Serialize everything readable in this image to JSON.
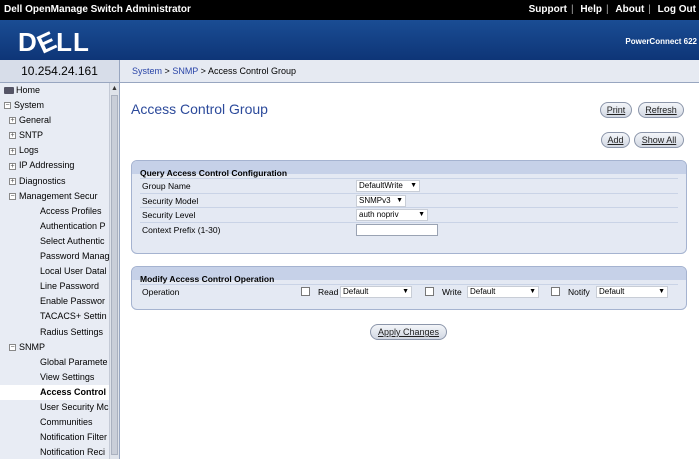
{
  "topbar": {
    "title": "Dell OpenManage Switch Administrator",
    "links": [
      "Support",
      "Help",
      "About",
      "Log Out"
    ]
  },
  "brand": {
    "logo": "DELL",
    "model": "PowerConnect 622"
  },
  "ip": "10.254.24.161",
  "breadcrumb": {
    "items": [
      "System",
      "SNMP"
    ],
    "current": "Access Control Group",
    "sep": ">"
  },
  "nav": {
    "items": [
      {
        "label": "Home",
        "icon": "home-icon"
      },
      {
        "label": "System",
        "icon": "minus-box-icon"
      },
      {
        "label": "General",
        "icon": "plus-box-icon"
      },
      {
        "label": "SNTP",
        "icon": "plus-box-icon"
      },
      {
        "label": "Logs",
        "icon": "plus-box-icon"
      },
      {
        "label": "IP Addressing",
        "icon": "plus-box-icon"
      },
      {
        "label": "Diagnostics",
        "icon": "plus-box-icon"
      },
      {
        "label": "Management Secur",
        "icon": "minus-box-icon"
      },
      {
        "label": "Access Profiles"
      },
      {
        "label": "Authentication P"
      },
      {
        "label": "Select Authentic"
      },
      {
        "label": "Password Manag"
      },
      {
        "label": "Local User Datal"
      },
      {
        "label": "Line Password"
      },
      {
        "label": "Enable Passwor"
      },
      {
        "label": "TACACS+ Settin"
      },
      {
        "label": "Radius Settings"
      },
      {
        "label": "SNMP",
        "icon": "minus-box-icon"
      },
      {
        "label": "Global Paramete"
      },
      {
        "label": "View Settings"
      },
      {
        "label": "Access Control"
      },
      {
        "label": "User Security Mc"
      },
      {
        "label": "Communities"
      },
      {
        "label": "Notification Filter"
      },
      {
        "label": "Notification Reci"
      }
    ]
  },
  "page": {
    "title": "Access Control Group"
  },
  "buttons": {
    "print": "Print",
    "refresh": "Refresh",
    "add": "Add",
    "show_all": "Show All",
    "apply": "Apply Changes"
  },
  "query": {
    "title": "Query Access Control Configuration",
    "group_name": {
      "label": "Group Name",
      "value": "DefaultWrite"
    },
    "security_model": {
      "label": "Security Model",
      "value": "SNMPv3"
    },
    "security_level": {
      "label": "Security Level",
      "value": "auth nopriv"
    },
    "context_prefix": {
      "label": "Context Prefix (1-30)",
      "value": ""
    }
  },
  "modify": {
    "title": "Modify Access Control Operation",
    "label": "Operation",
    "read": {
      "label": "Read",
      "value": "Default"
    },
    "write": {
      "label": "Write",
      "value": "Default"
    },
    "notify": {
      "label": "Notify",
      "value": "Default"
    }
  }
}
